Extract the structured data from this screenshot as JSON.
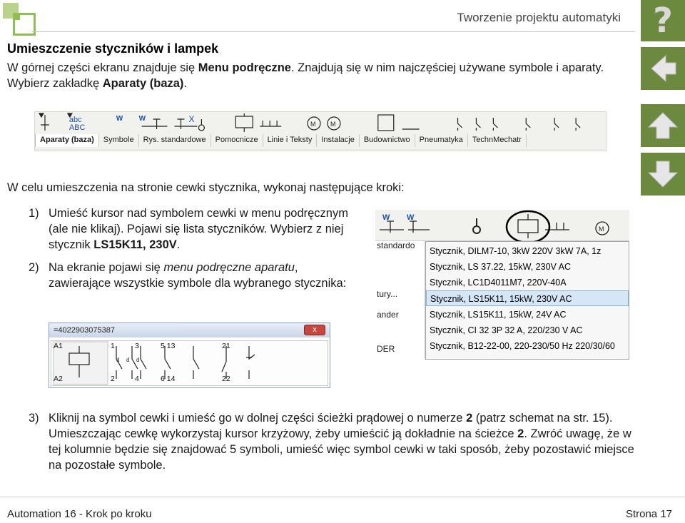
{
  "header": {
    "title": "Tworzenie projektu automatyki",
    "help_glyph": "?"
  },
  "section": {
    "title": "Umieszczenie styczników i lampek"
  },
  "intro": {
    "a": "W górnej części ekranu znajduje się ",
    "b": "Menu podręczne",
    "c": ". Znajdują się w nim najczęściej używane symbole i aparaty. Wybierz zakładkę ",
    "d": "Aparaty (baza)",
    "e": "."
  },
  "toolbar": {
    "tabs": [
      "Aparaty (baza)",
      "Symbole",
      "Rys. standardowe",
      "Pomocnicze",
      "Linie i Teksty",
      "Instalacje",
      "Budownictwo",
      "Pneumatyka",
      "TechnMechatr"
    ],
    "icon_text_1": "abc",
    "icon_text_2": "ABC",
    "icon_w": "W",
    "icon_x": "X",
    "icon_m": "M"
  },
  "instructions": {
    "lead": "W celu umieszczenia na stronie cewki stycznika, wykonaj następujące kroki:",
    "step1_num": "1)",
    "step1_a": "Umieść kursor nad symbolem cewki w menu podręcznym (ale nie klikaj). Pojawi się lista styczników. Wybierz z niej stycznik ",
    "step1_b": "LS15K11, 230V",
    "step1_c": ".",
    "step2_num": "2)",
    "step2_a": "Na ekranie pojawi się ",
    "step2_b": "menu podręczne aparatu",
    "step2_c": ", zawierające wszystkie symbole dla wybranego stycznika:",
    "step3_num": "3)",
    "step3_a": "Kliknij na symbol cewki i umieść go w dolnej części ścieżki prądowej o numerze ",
    "step3_b": "2",
    "step3_c": " (patrz schemat na str. 15). Umieszczając cewkę wykorzystaj kursor krzyżowy, żeby umieścić ją dokładnie na ścieżce ",
    "step3_d": "2",
    "step3_e": ". Zwróć uwagę, że w tej kolumnie będzie się znajdować 5 symboli, umieść więc symbol cewki w taki sposób, żeby pozostawić miejsce na pozostałe symbole."
  },
  "dropdown": {
    "left_fragments": [
      "standardo",
      "tury...",
      "ander",
      "DER"
    ],
    "top_w": "W",
    "top_m": "M",
    "items": [
      "Stycznik, DILM7-10, 3kW 220V  3kW 7A, 1z",
      "Stycznik, LS 37.22, 15kW, 230V AC",
      "Stycznik, LC1D4011M7, 220V-40A",
      "Stycznik, LS15K11, 15kW, 230V AC",
      "Stycznik, LS15K11, 15kW, 24V AC",
      "Stycznik, CI 32 3P 32 A, 220/230 V AC",
      "Stycznik, B12-22-00,  220-230/50 Hz 220/30/60"
    ],
    "highlighted": 3
  },
  "contact_window": {
    "title": "=4022903075387",
    "close": "x",
    "labels_top": [
      "A1",
      "1",
      "3",
      "5 13",
      "21"
    ],
    "labels_bottom": [
      "A2",
      "2",
      "4",
      "6 14",
      "22"
    ]
  },
  "footer": {
    "left": "Automation 16 - Krok po kroku",
    "right": "Strona 17"
  },
  "colors": {
    "nav_green": "#6b8a3e",
    "logo_green": "#8dbf52",
    "highlight": "#d5e6f7"
  }
}
